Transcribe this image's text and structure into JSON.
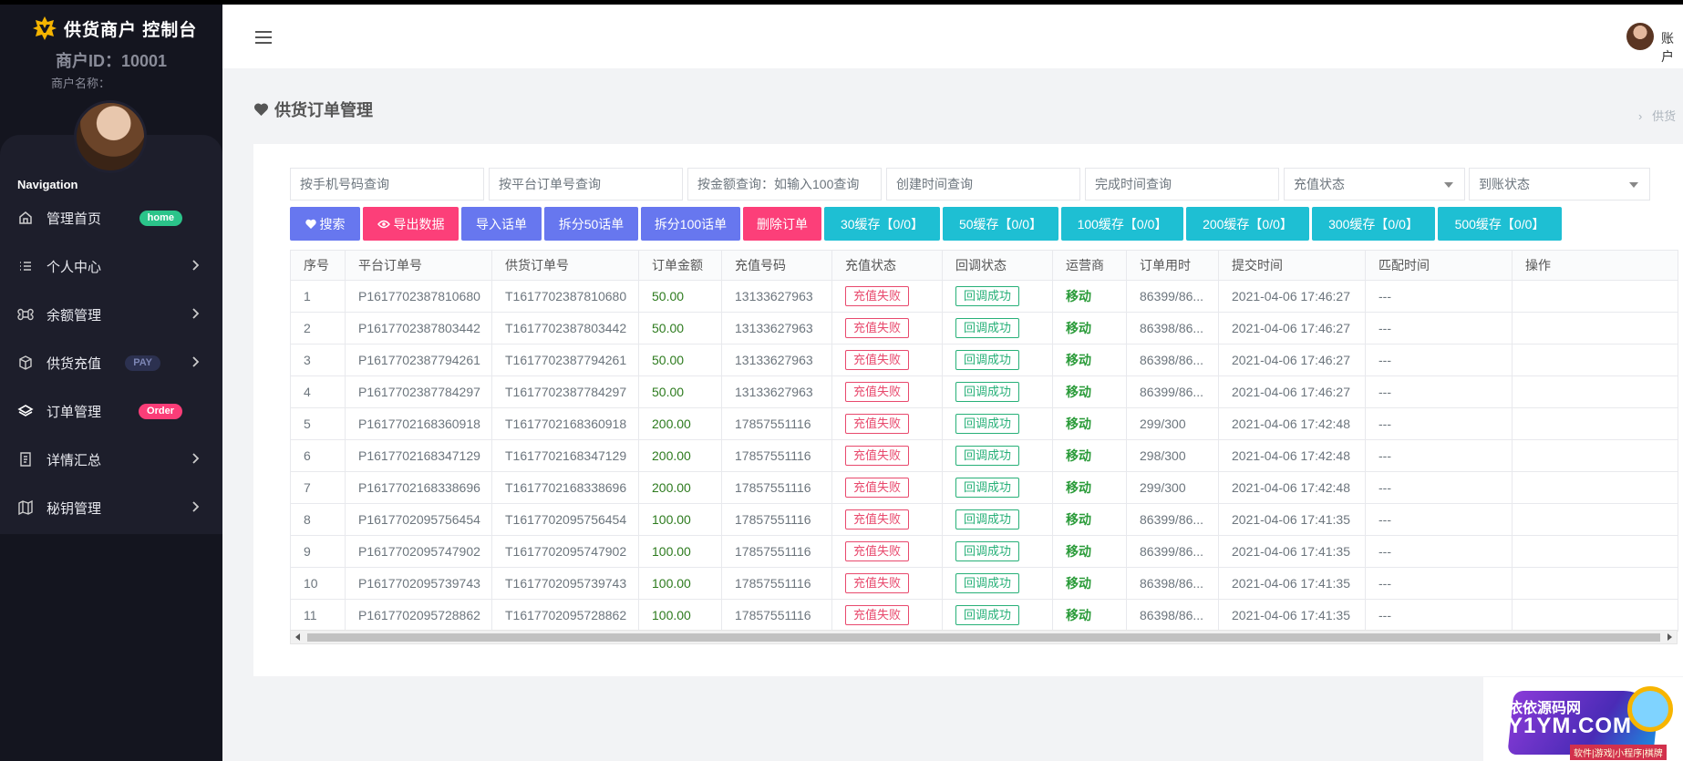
{
  "sidebar": {
    "brand": "供货商户 控制台",
    "merchant_id": "商户ID：10001",
    "merchant_name_label": "商户名称：",
    "nav_title": "Navigation",
    "items": [
      {
        "label": "管理首页",
        "badge": "home",
        "icon": "home-icon"
      },
      {
        "label": "个人中心",
        "icon": "list-icon"
      },
      {
        "label": "余额管理",
        "icon": "command-icon"
      },
      {
        "label": "供货充值",
        "badge": "PAY",
        "icon": "box-icon"
      },
      {
        "label": "订单管理",
        "badge": "Order",
        "icon": "layers-icon"
      },
      {
        "label": "详情汇总",
        "icon": "document-icon"
      },
      {
        "label": "秘钥管理",
        "icon": "map-icon"
      }
    ]
  },
  "header": {
    "account": "账户"
  },
  "page": {
    "title": "供货订单管理",
    "breadcrumb": "供货"
  },
  "filters": {
    "phone_placeholder": "按手机号码查询",
    "platform_order_placeholder": "按平台订单号查询",
    "amount_placeholder": "按金额查询：如输入100查询",
    "create_time_placeholder": "创建时间查询",
    "finish_time_placeholder": "完成时间查询",
    "recharge_status": "充值状态",
    "arrival_status": "到账状态"
  },
  "buttons": {
    "search": "搜索",
    "export": "导出数据",
    "import": "导入话单",
    "split50": "拆分50话单",
    "split100": "拆分100话单",
    "delete": "删除订单",
    "cache30": "30缓存【0/0】",
    "cache50": "50缓存【0/0】",
    "cache100": "100缓存【0/0】",
    "cache200": "200缓存【0/0】",
    "cache300": "300缓存【0/0】",
    "cache500": "500缓存【0/0】"
  },
  "table": {
    "headers": [
      "序号",
      "平台订单号",
      "供货订单号",
      "订单金额",
      "充值号码",
      "充值状态",
      "回调状态",
      "运营商",
      "订单用时",
      "提交时间",
      "匹配时间",
      "操作"
    ],
    "rows": [
      {
        "no": "1",
        "platform": "P1617702387810680",
        "supply": "T1617702387810680",
        "amount": "50.00",
        "phone": "13133627963",
        "recharge": "充值失败",
        "callback": "回调成功",
        "carrier": "移动",
        "used": "86399/86...",
        "submit": "2021-04-06 17:46:27",
        "match": "---",
        "op": ""
      },
      {
        "no": "2",
        "platform": "P1617702387803442",
        "supply": "T1617702387803442",
        "amount": "50.00",
        "phone": "13133627963",
        "recharge": "充值失败",
        "callback": "回调成功",
        "carrier": "移动",
        "used": "86398/86...",
        "submit": "2021-04-06 17:46:27",
        "match": "---",
        "op": ""
      },
      {
        "no": "3",
        "platform": "P1617702387794261",
        "supply": "T1617702387794261",
        "amount": "50.00",
        "phone": "13133627963",
        "recharge": "充值失败",
        "callback": "回调成功",
        "carrier": "移动",
        "used": "86398/86...",
        "submit": "2021-04-06 17:46:27",
        "match": "---",
        "op": ""
      },
      {
        "no": "4",
        "platform": "P1617702387784297",
        "supply": "T1617702387784297",
        "amount": "50.00",
        "phone": "13133627963",
        "recharge": "充值失败",
        "callback": "回调成功",
        "carrier": "移动",
        "used": "86399/86...",
        "submit": "2021-04-06 17:46:27",
        "match": "---",
        "op": ""
      },
      {
        "no": "5",
        "platform": "P1617702168360918",
        "supply": "T1617702168360918",
        "amount": "200.00",
        "phone": "17857551116",
        "recharge": "充值失败",
        "callback": "回调成功",
        "carrier": "移动",
        "used": "299/300",
        "submit": "2021-04-06 17:42:48",
        "match": "---",
        "op": ""
      },
      {
        "no": "6",
        "platform": "P1617702168347129",
        "supply": "T1617702168347129",
        "amount": "200.00",
        "phone": "17857551116",
        "recharge": "充值失败",
        "callback": "回调成功",
        "carrier": "移动",
        "used": "298/300",
        "submit": "2021-04-06 17:42:48",
        "match": "---",
        "op": ""
      },
      {
        "no": "7",
        "platform": "P1617702168338696",
        "supply": "T1617702168338696",
        "amount": "200.00",
        "phone": "17857551116",
        "recharge": "充值失败",
        "callback": "回调成功",
        "carrier": "移动",
        "used": "299/300",
        "submit": "2021-04-06 17:42:48",
        "match": "---",
        "op": ""
      },
      {
        "no": "8",
        "platform": "P1617702095756454",
        "supply": "T1617702095756454",
        "amount": "100.00",
        "phone": "17857551116",
        "recharge": "充值失败",
        "callback": "回调成功",
        "carrier": "移动",
        "used": "86399/86...",
        "submit": "2021-04-06 17:41:35",
        "match": "---",
        "op": ""
      },
      {
        "no": "9",
        "platform": "P1617702095747902",
        "supply": "T1617702095747902",
        "amount": "100.00",
        "phone": "17857551116",
        "recharge": "充值失败",
        "callback": "回调成功",
        "carrier": "移动",
        "used": "86399/86...",
        "submit": "2021-04-06 17:41:35",
        "match": "---",
        "op": ""
      },
      {
        "no": "10",
        "platform": "P1617702095739743",
        "supply": "T1617702095739743",
        "amount": "100.00",
        "phone": "17857551116",
        "recharge": "充值失败",
        "callback": "回调成功",
        "carrier": "移动",
        "used": "86398/86...",
        "submit": "2021-04-06 17:41:35",
        "match": "---",
        "op": ""
      },
      {
        "no": "11",
        "platform": "P1617702095728862",
        "supply": "T1617702095728862",
        "amount": "100.00",
        "phone": "17857551116",
        "recharge": "充值失败",
        "callback": "回调成功",
        "carrier": "移动",
        "used": "86398/86...",
        "submit": "2021-04-06 17:41:35",
        "match": "---",
        "op": ""
      }
    ]
  },
  "watermark": {
    "line1": "依依源码网",
    "line2": "Y1YM.COM",
    "line3": "软件|游戏|小程序|棋牌"
  },
  "colors": {
    "sidebar_bg": "#14151f",
    "primary": "#6777ef",
    "danger": "#fc3f79",
    "info": "#1ebfd3",
    "success": "#2bc48a"
  }
}
